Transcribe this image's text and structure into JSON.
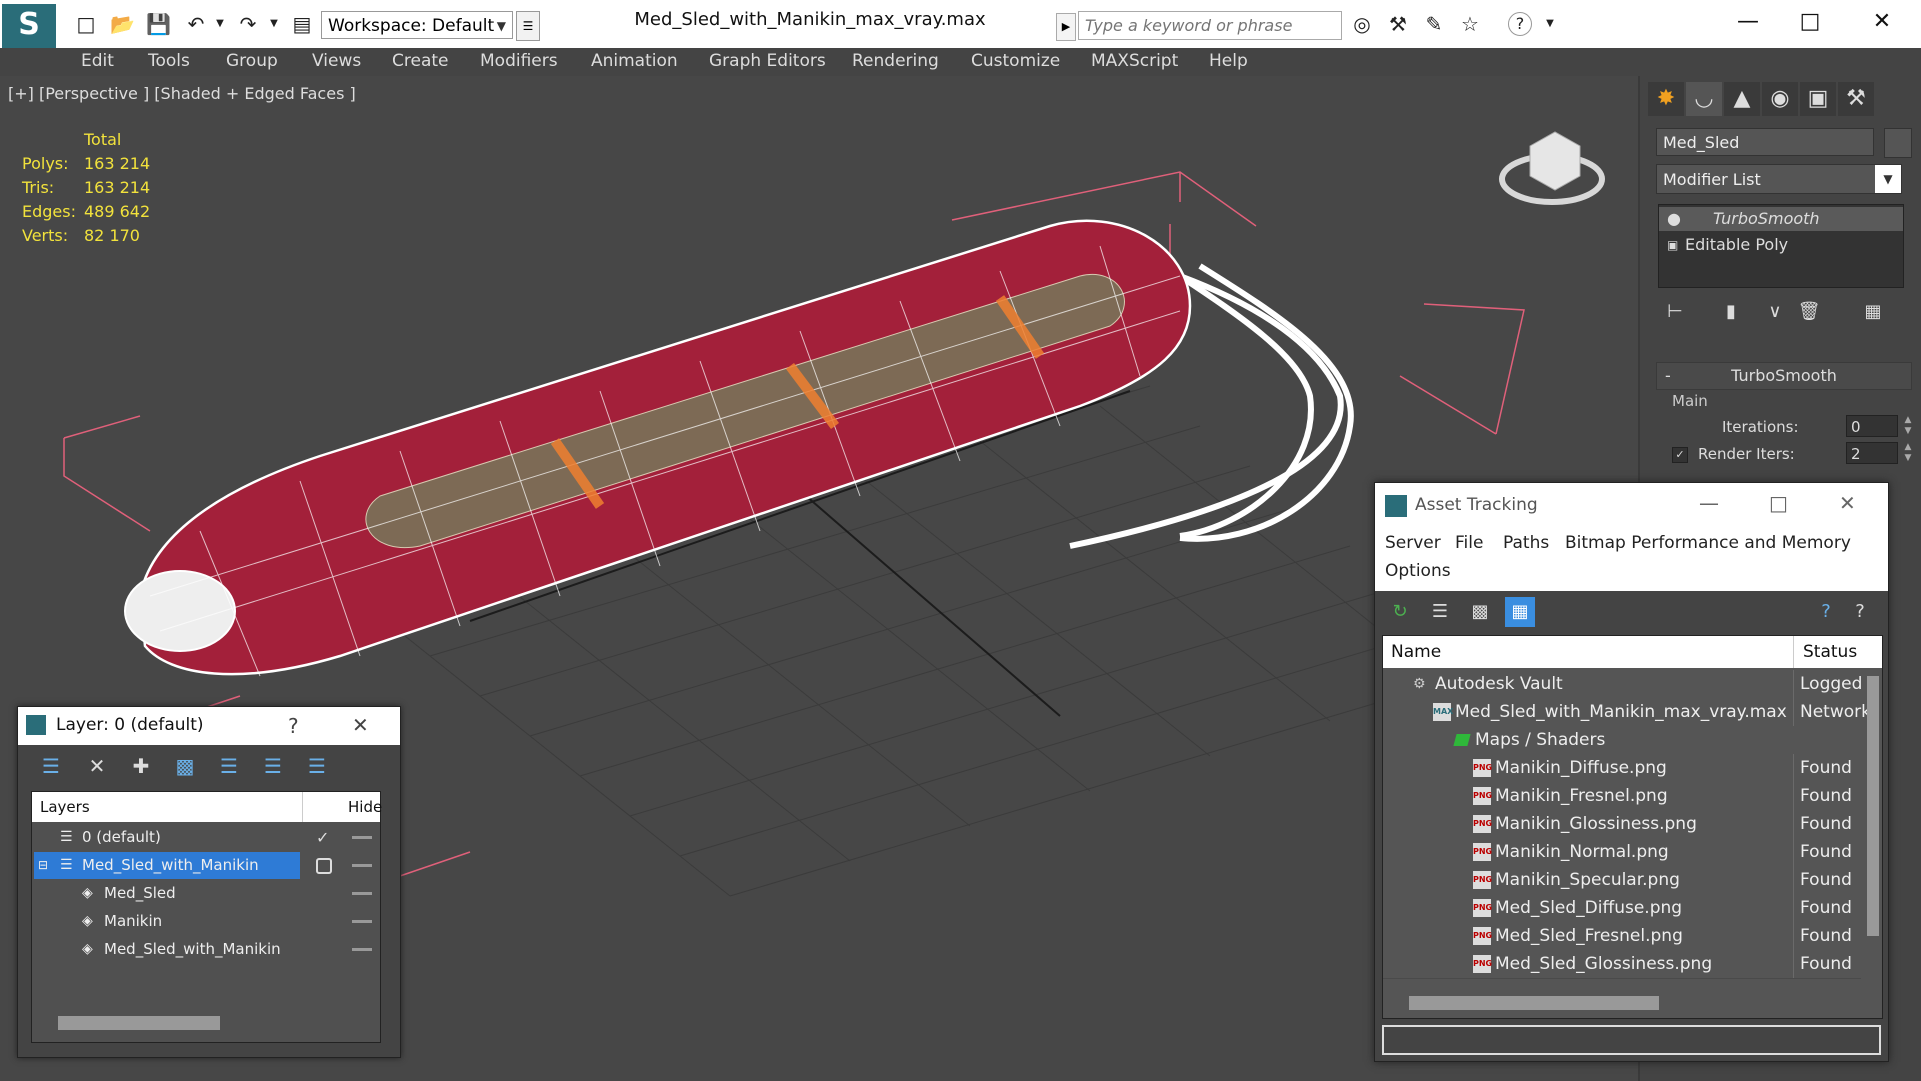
{
  "titlebar": {
    "workspace": "Workspace: Default",
    "file_title": "Med_Sled_with_Manikin_max_vray.max",
    "search_placeholder": "Type a keyword or phrase"
  },
  "menubar": [
    "Edit",
    "Tools",
    "Group",
    "Views",
    "Create",
    "Modifiers",
    "Animation",
    "Graph Editors",
    "Rendering",
    "Customize",
    "MAXScript",
    "Help"
  ],
  "viewport": {
    "label": "[+] [Perspective ] [Shaded + Edged Faces ]",
    "stats_header": "Total",
    "stats": [
      {
        "label": "Polys:",
        "value": "163 214"
      },
      {
        "label": "Tris:",
        "value": "163 214"
      },
      {
        "label": "Edges:",
        "value": "489 642"
      },
      {
        "label": "Verts:",
        "value": "82 170"
      }
    ]
  },
  "command_panel": {
    "object_name": "Med_Sled",
    "modifier_list": "Modifier List",
    "stack": [
      "TurboSmooth",
      "Editable Poly"
    ],
    "rollout_title": "TurboSmooth",
    "group_label": "Main",
    "iterations_label": "Iterations:",
    "iterations_value": "0",
    "render_iters_label": "Render Iters:",
    "render_iters_value": "2"
  },
  "layer_dialog": {
    "title": "Layer: 0 (default)",
    "help": "?",
    "col_layers": "Layers",
    "col_hide": "Hide",
    "rows": [
      {
        "name": "0 (default)"
      },
      {
        "name": "Med_Sled_with_Manikin"
      },
      {
        "name": "Med_Sled"
      },
      {
        "name": "Manikin"
      },
      {
        "name": "Med_Sled_with_Manikin"
      }
    ]
  },
  "asset_dialog": {
    "title": "Asset Tracking",
    "menu": [
      "Server",
      "File",
      "Paths",
      "Bitmap Performance and Memory",
      "Options"
    ],
    "col_name": "Name",
    "col_status": "Status",
    "rows": [
      {
        "name": "Autodesk Vault",
        "status": "Logged"
      },
      {
        "name": "Med_Sled_with_Manikin_max_vray.max",
        "status": "Network"
      },
      {
        "name": "Maps / Shaders",
        "status": ""
      },
      {
        "name": "Manikin_Diffuse.png",
        "status": "Found"
      },
      {
        "name": "Manikin_Fresnel.png",
        "status": "Found"
      },
      {
        "name": "Manikin_Glossiness.png",
        "status": "Found"
      },
      {
        "name": "Manikin_Normal.png",
        "status": "Found"
      },
      {
        "name": "Manikin_Specular.png",
        "status": "Found"
      },
      {
        "name": "Med_Sled_Diffuse.png",
        "status": "Found"
      },
      {
        "name": "Med_Sled_Fresnel.png",
        "status": "Found"
      },
      {
        "name": "Med_Sled_Glossiness.png",
        "status": "Found"
      }
    ]
  },
  "colors": {
    "stats_yellow": "#f2e23c",
    "sled_red": "#a3203a",
    "wire_white": "#ffffff",
    "selection_blue": "#2e7bd6"
  }
}
